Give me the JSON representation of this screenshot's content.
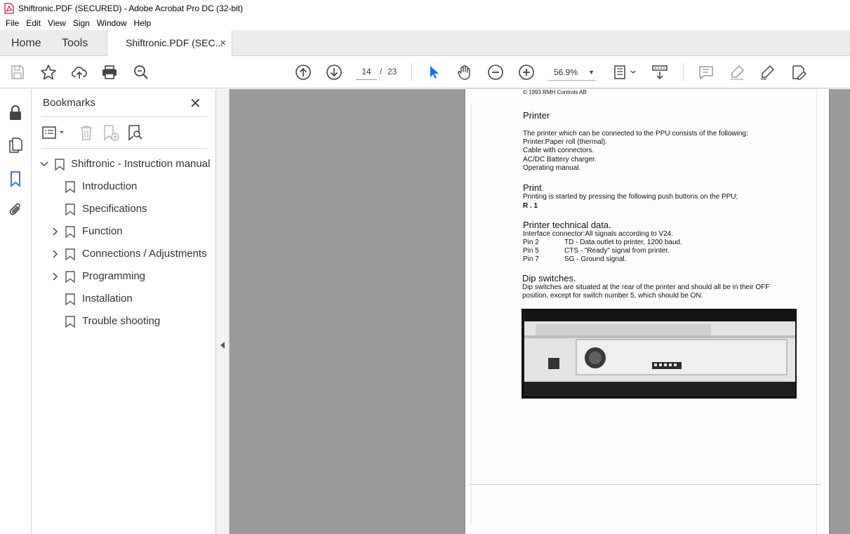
{
  "window": {
    "title": "Shiftronic.PDF (SECURED) - Adobe Acrobat Pro DC (32-bit)",
    "app_icon": "acrobat-pdf-icon"
  },
  "menubar": [
    "File",
    "Edit",
    "View",
    "Sign",
    "Window",
    "Help"
  ],
  "tabs": {
    "home": "Home",
    "tools": "Tools",
    "document": "Shiftronic.PDF (SEC...",
    "close_glyph": "×"
  },
  "toolbar": {
    "current_page": "14",
    "page_separator": "/",
    "total_pages": "23",
    "zoom": "56.9%",
    "icons": [
      "save-icon",
      "bookmark-star-icon",
      "upload-cloud-icon",
      "print-icon",
      "search-zoom-icon",
      "page-up-icon",
      "page-down-icon",
      "select-cursor-icon",
      "hand-icon",
      "zoom-out-icon",
      "zoom-in-icon",
      "page-fit-icon",
      "scroll-mode-icon",
      "comment-icon",
      "highlight-icon",
      "sign-icon",
      "fill-sign-icon"
    ]
  },
  "rail": [
    "lock-icon",
    "pages-icon",
    "bookmarks-icon",
    "attachment-icon"
  ],
  "bookmarks_panel": {
    "title": "Bookmarks",
    "close_glyph": "✕",
    "items": [
      {
        "label": "Shiftronic - Instruction manual",
        "level": 0,
        "expander": "expanded"
      },
      {
        "label": "Introduction",
        "level": 1,
        "expander": "none"
      },
      {
        "label": "Specifications",
        "level": 1,
        "expander": "none"
      },
      {
        "label": "Function",
        "level": 1,
        "expander": "collapsed"
      },
      {
        "label": "Connections / Adjustments",
        "level": 1,
        "expander": "collapsed"
      },
      {
        "label": "Programming",
        "level": 1,
        "expander": "collapsed"
      },
      {
        "label": "Installation",
        "level": 1,
        "expander": "none"
      },
      {
        "label": "Trouble shooting",
        "level": 1,
        "expander": "none"
      }
    ]
  },
  "page": {
    "copyright": "© 1993 RMH Controls AB",
    "printer_heading": "Printer",
    "printer_lines": [
      "The printer which can be connected to the PPU consists of the following:",
      "Printer.Paper roll (thermal).",
      "Cable with connectors.",
      "AC/DC Battery charger.",
      "Operating manual."
    ],
    "print_heading": "Print",
    "print_line": "Printing is started by pressing the following push buttons on the PPU;",
    "print_code": "R . 1",
    "tech_heading": "Printer technical data.",
    "tech_intro": "Interface connector:All signals according to V24.",
    "pins": [
      {
        "pin": "Pin 2",
        "desc": "TD - Data outlet to printer, 1200 baud."
      },
      {
        "pin": "Pin 5",
        "desc": "CTS - \"Ready\" signal from printer."
      },
      {
        "pin": "Pin 7",
        "desc": "SG - Ground signal."
      }
    ],
    "dip_heading": "Dip switches.",
    "dip_lines": [
      "Dip switches are situated at the rear of the printer and should all be in their OFF",
      "position, except for switch number 5, which should be ON."
    ]
  }
}
